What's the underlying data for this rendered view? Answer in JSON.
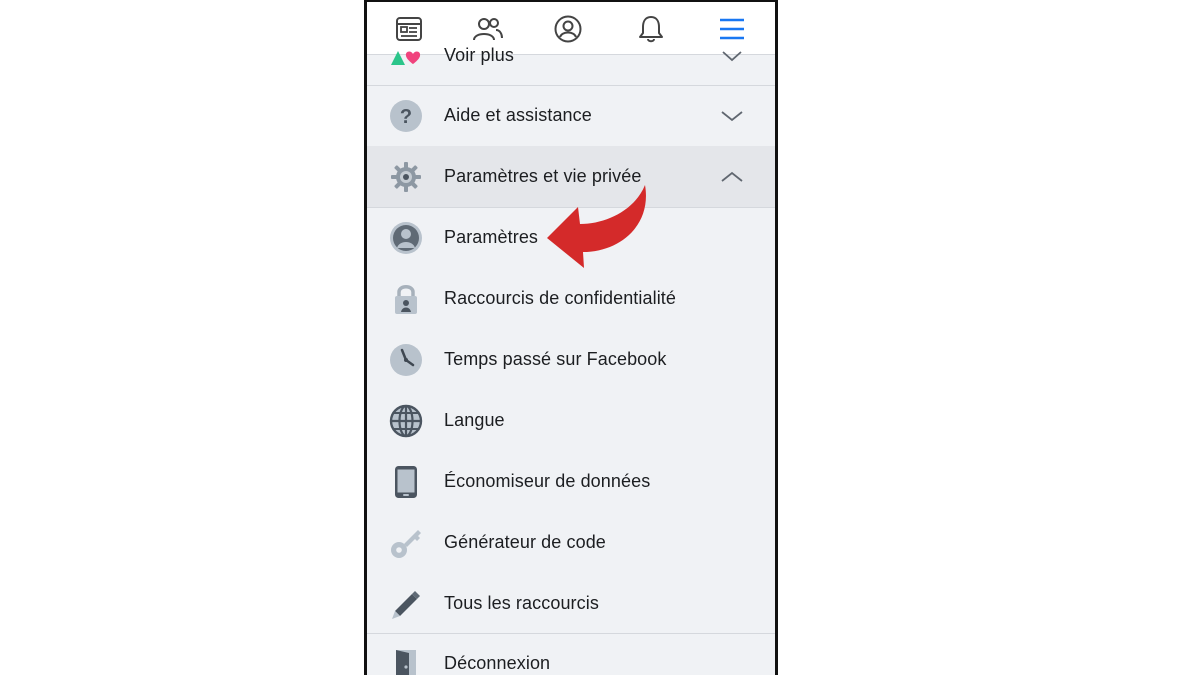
{
  "topnav": {
    "items": [
      {
        "name": "news-feed-icon"
      },
      {
        "name": "friends-icon"
      },
      {
        "name": "profile-icon"
      },
      {
        "name": "notifications-icon"
      },
      {
        "name": "menu-icon"
      }
    ],
    "accent": "#1877f2"
  },
  "menu": {
    "see_more": {
      "label": "Voir plus",
      "icon": "shapes-icon"
    },
    "help": {
      "label": "Aide et assistance",
      "icon": "question-icon"
    },
    "settings_privacy": {
      "label": "Paramètres et vie privée",
      "icon": "gear-icon"
    },
    "sub_items": [
      {
        "label": "Paramètres",
        "icon": "user-circle-icon"
      },
      {
        "label": "Raccourcis de confidentialité",
        "icon": "lock-icon"
      },
      {
        "label": "Temps passé sur Facebook",
        "icon": "clock-icon"
      },
      {
        "label": "Langue",
        "icon": "globe-icon"
      },
      {
        "label": "Économiseur de données",
        "icon": "phone-icon"
      },
      {
        "label": "Générateur de code",
        "icon": "key-icon"
      },
      {
        "label": "Tous les raccourcis",
        "icon": "pencil-icon"
      }
    ],
    "logout": {
      "label": "Déconnexion",
      "icon": "door-icon"
    }
  },
  "annotation": {
    "icon": "red-curved-arrow-icon",
    "color": "#d42a2a"
  }
}
